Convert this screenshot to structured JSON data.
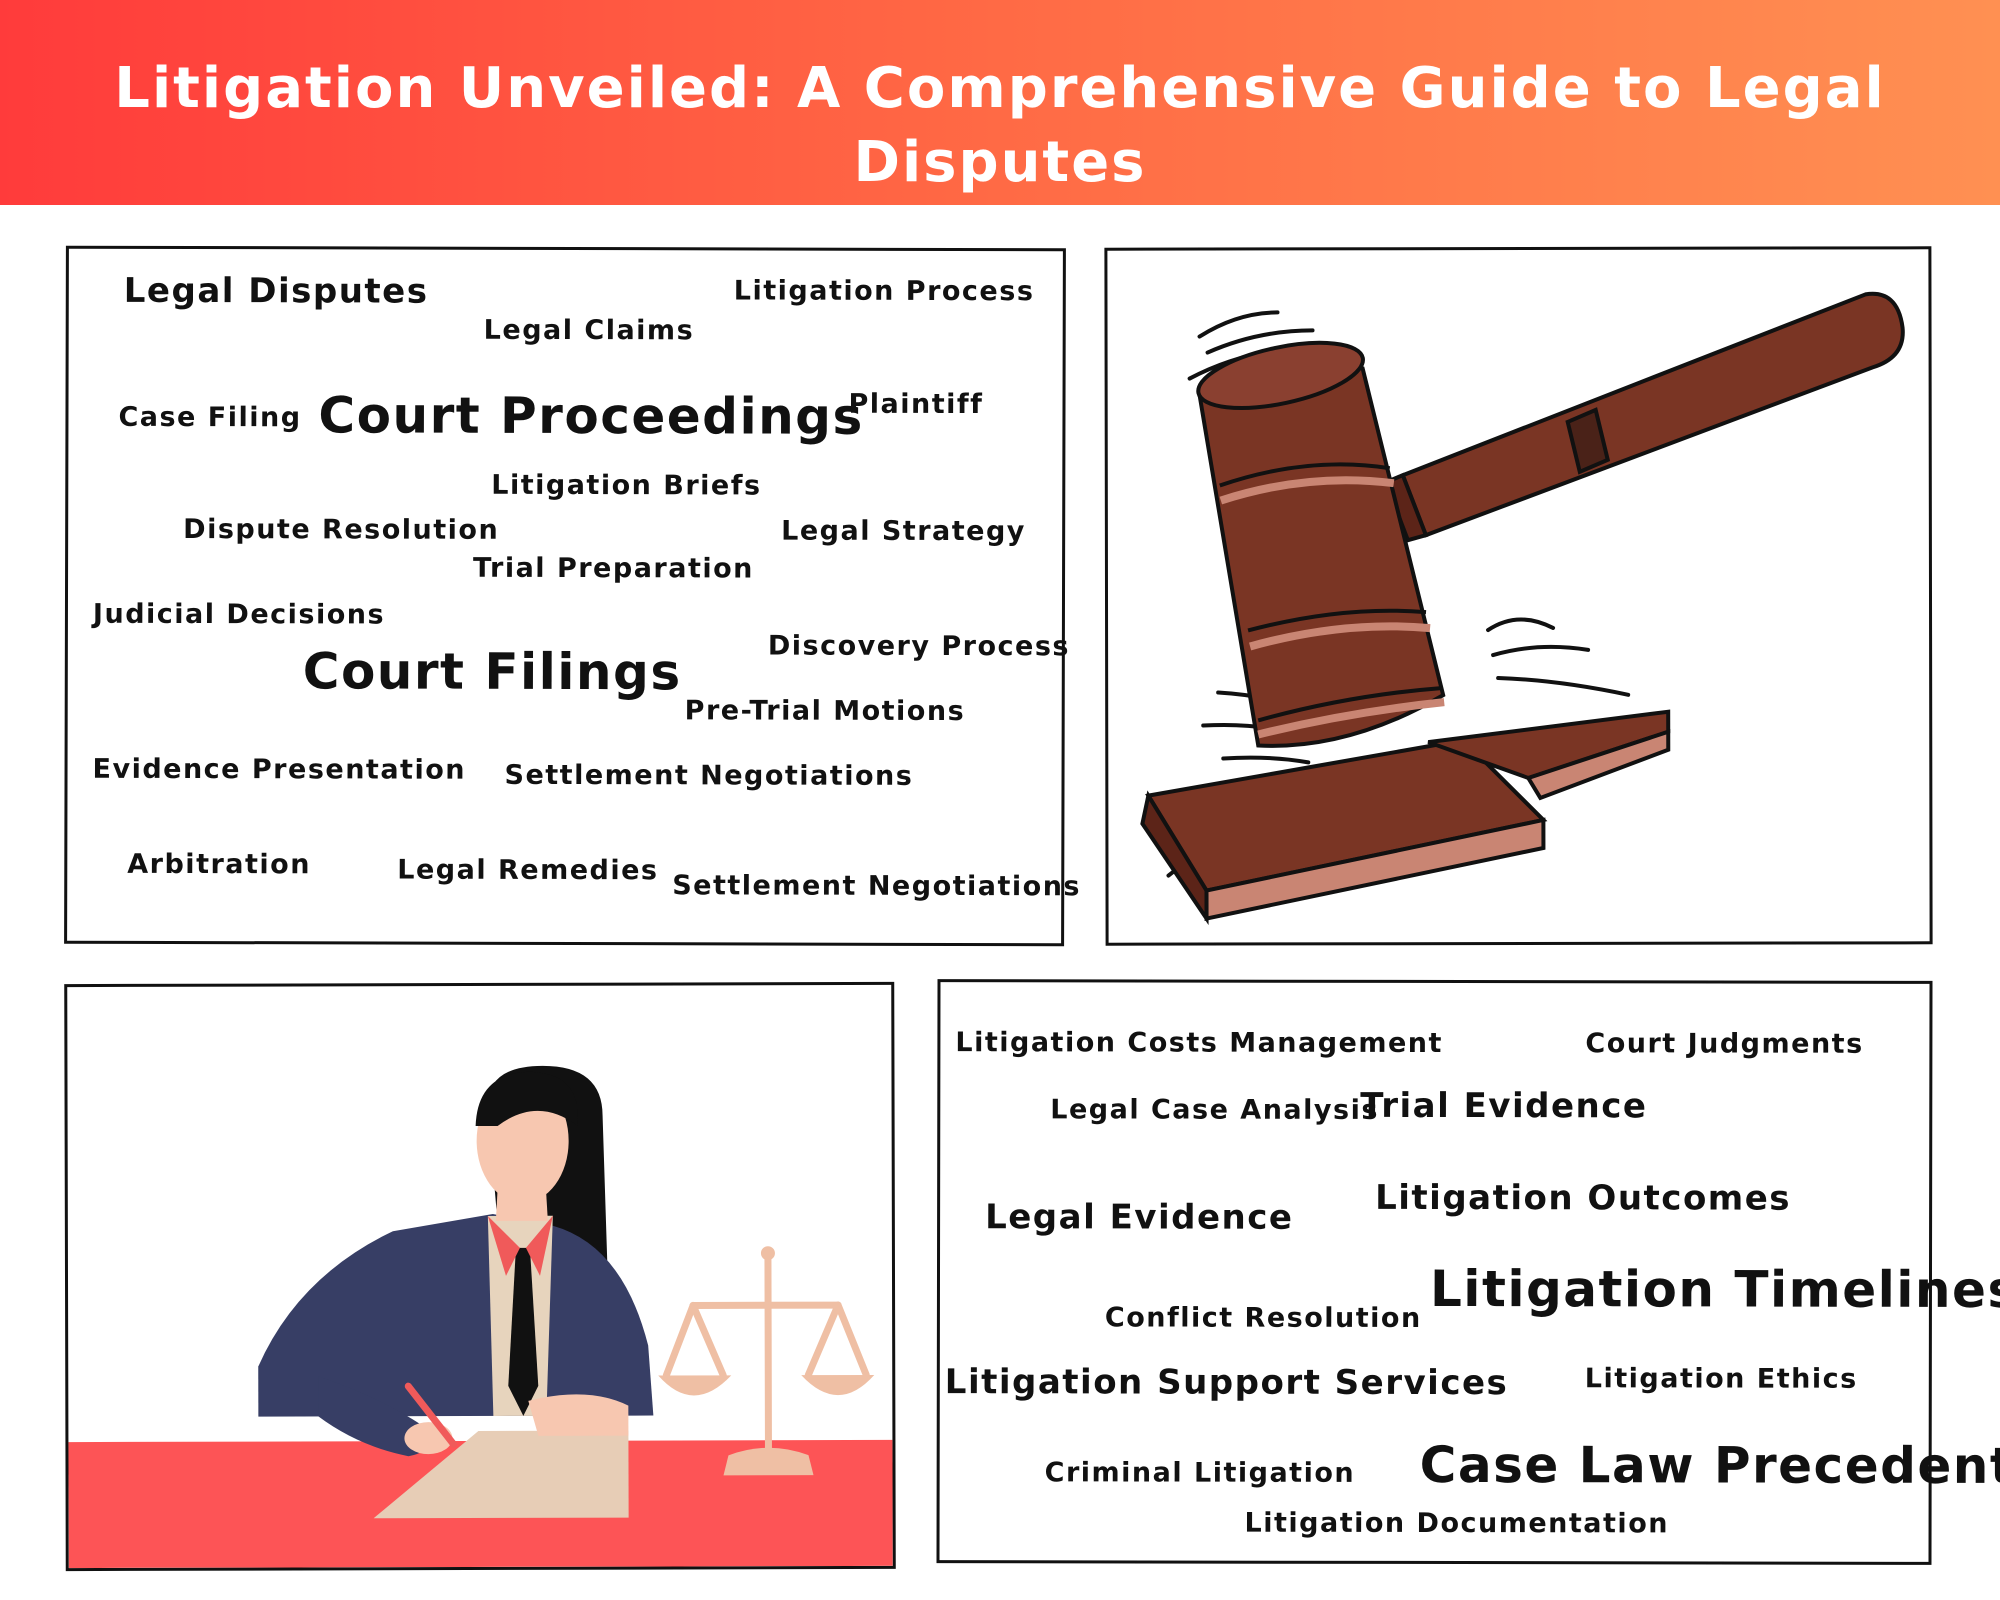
{
  "title": "Litigation Unveiled: A Comprehensive Guide to Legal Disputes",
  "colors": {
    "header_gradient_start": "#ff3b3b",
    "header_gradient_end": "#ff9052",
    "gavel_brown": "#7a3524",
    "desk_red": "#fd5456",
    "suit_navy": "#373e65",
    "scale_beige": "#efbfa4"
  },
  "word_cloud_1": [
    "Legal Disputes",
    "Legal Claims",
    "Litigation Process",
    "Case Filing",
    "Court Proceedings",
    "Plaintiff",
    "Litigation Briefs",
    "Dispute Resolution",
    "Legal Strategy",
    "Trial Preparation",
    "Judicial Decisions",
    "Discovery Process",
    "Court Filings",
    "Pre-Trial Motions",
    "Evidence Presentation",
    "Settlement Negotiations",
    "Arbitration",
    "Legal Remedies",
    "Settlement Negotiations"
  ],
  "word_cloud_2": [
    "Litigation Costs Management",
    "Court Judgments",
    "Legal Case Analysis",
    "Trial Evidence",
    "Legal Evidence",
    "Litigation Outcomes",
    "Conflict Resolution",
    "Litigation Timelines",
    "Litigation Support Services",
    "Litigation Ethics",
    "Criminal Litigation",
    "Case Law Precedents",
    "Litigation Documentation"
  ],
  "illustrations": {
    "gavel": "gavel-striking-block-illustration",
    "lawyer": "lawyer-writing-at-desk-with-scales-illustration"
  }
}
